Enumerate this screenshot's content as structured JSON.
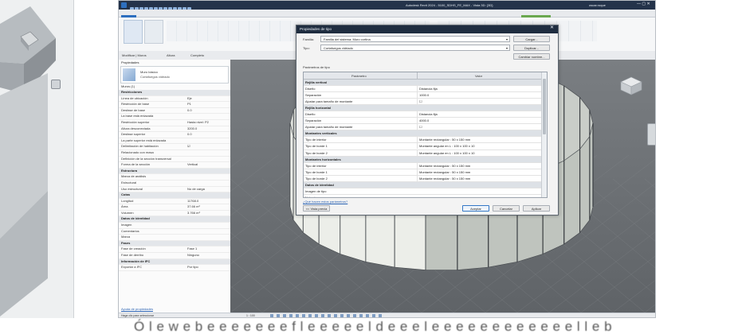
{
  "window": {
    "title": "Autodesk Revit 2024 - 5100_SDHS_FE_MAX - Vista 3D: {3D}",
    "user": "oscar.roque"
  },
  "ribbon": {
    "tabs": [
      "Archivo",
      "Arquitectura",
      "Estructura",
      "Acero",
      "Prefabricación",
      "Sistemas",
      "Insertar",
      "Anotar",
      "Analizar",
      "Masa y emplazamiento",
      "Colaborar",
      "Vista",
      "Gestionar",
      "Complementos",
      "Escalar",
      "Herramientas de Manipulación",
      "Quantification",
      "Fabricación",
      "Modificar | Muros",
      "Ver"
    ],
    "active_tab": "Archivo",
    "highlight_tab": "Modificar | Muros",
    "panel_labels": [
      "Seleccionar ▾",
      "Propiedades",
      "Portapapeles",
      "Geometría",
      "Modificar",
      "Vista",
      "Medir",
      "Crear",
      "Modo",
      "Modificar muro"
    ]
  },
  "options_bar": {
    "text": "Modificar | Muros",
    "items": [
      "Altura",
      "Completo"
    ]
  },
  "properties": {
    "header": "Propiedades",
    "type_name": "Muro básico",
    "type_sub": "Cortafuegos vidriado",
    "instance": "Muros (1)",
    "rows": [
      {
        "k": "Restricciones",
        "v": "",
        "grp": true
      },
      {
        "k": "Línea de ubicación",
        "v": "Eje"
      },
      {
        "k": "Restricción de base",
        "v": "P1"
      },
      {
        "k": "Desfase de base",
        "v": "0.0"
      },
      {
        "k": "La base está enlazada",
        "v": ""
      },
      {
        "k": "Restricción superior",
        "v": "Hasta nivel: P2"
      },
      {
        "k": "Altura desconectada",
        "v": "3200.0"
      },
      {
        "k": "Desfase superior",
        "v": "0.0"
      },
      {
        "k": "La parte superior está enlazada",
        "v": ""
      },
      {
        "k": "Delimitación de habitación",
        "v": "☑"
      },
      {
        "k": "Relacionado con masa",
        "v": ""
      },
      {
        "k": "Definición de la sección transversal",
        "v": ""
      },
      {
        "k": "Forma de la sección",
        "v": "Vertical"
      },
      {
        "k": "Estructura",
        "v": "",
        "grp": true
      },
      {
        "k": "Marca de análisis",
        "v": ""
      },
      {
        "k": "Estructural",
        "v": ""
      },
      {
        "k": "Uso estructural",
        "v": "No de carga"
      },
      {
        "k": "Cotas",
        "v": "",
        "grp": true
      },
      {
        "k": "Longitud",
        "v": "11768.0"
      },
      {
        "k": "Área",
        "v": "37.66 m²"
      },
      {
        "k": "Volumen",
        "v": "3.766 m³"
      },
      {
        "k": "Datos de identidad",
        "v": "",
        "grp": true
      },
      {
        "k": "Imagen",
        "v": ""
      },
      {
        "k": "Comentarios",
        "v": ""
      },
      {
        "k": "Marca",
        "v": ""
      },
      {
        "k": "Fases",
        "v": "",
        "grp": true
      },
      {
        "k": "Fase de creación",
        "v": "Fase 1"
      },
      {
        "k": "Fase de derribo",
        "v": "Ninguno"
      },
      {
        "k": "Información de IFC",
        "v": "",
        "grp": true
      },
      {
        "k": "Exportar a IFC",
        "v": "Por tipo"
      }
    ],
    "help_link": "Ayuda de propiedades",
    "apply": "Aplicar"
  },
  "dialog": {
    "title": "Propiedades de tipo",
    "family_label": "Familia:",
    "family_value": "Familia del sistema: Muro cortina",
    "type_label": "Tipo:",
    "type_value": "Cortafuegos vidriado",
    "load_btn": "Cargar...",
    "duplicate_btn": "Duplicar...",
    "rename_btn": "Cambiar nombre...",
    "params_label": "Parámetros de tipo",
    "col_param": "Parámetro",
    "col_value": "Valor",
    "rows": [
      {
        "p": "Rejilla vertical",
        "v": "",
        "grp": true
      },
      {
        "p": "Diseño",
        "v": "Distancia fija"
      },
      {
        "p": "Separación",
        "v": "1000.0"
      },
      {
        "p": "Ajustar para tamaño de montante",
        "v": "☐"
      },
      {
        "p": "Rejilla horizontal",
        "v": "",
        "grp": true
      },
      {
        "p": "Diseño",
        "v": "Distancia fija"
      },
      {
        "p": "Separación",
        "v": "4000.0"
      },
      {
        "p": "Ajustar para tamaño de montante",
        "v": "☐"
      },
      {
        "p": "Montantes verticales",
        "v": "",
        "grp": true
      },
      {
        "p": "Tipo de interior",
        "v": "Montante rectangular : 50 x 150 mm"
      },
      {
        "p": "Tipo de borde 1",
        "v": "Montante angular en L : 100 x 100 x 10"
      },
      {
        "p": "Tipo de borde 2",
        "v": "Montante angular en L : 100 x 100 x 10"
      },
      {
        "p": "Montantes horizontales",
        "v": "",
        "grp": true
      },
      {
        "p": "Tipo de interior",
        "v": "Montante rectangular : 50 x 150 mm"
      },
      {
        "p": "Tipo de borde 1",
        "v": "Montante rectangular : 50 x 150 mm"
      },
      {
        "p": "Tipo de borde 2",
        "v": "Montante rectangular : 50 x 150 mm"
      },
      {
        "p": "Datos de identidad",
        "v": "",
        "grp": true
      },
      {
        "p": "Imagen de tipo",
        "v": ""
      },
      {
        "p": "Nota clave",
        "v": ""
      }
    ],
    "help_link": "¿Qué hacen estos parámetros?",
    "preview_btn": "<< Vista previa",
    "ok_btn": "Aceptar",
    "cancel_btn": "Cancelar",
    "apply_btn": "Aplicar"
  },
  "status_bar": {
    "text": "Haga clic para seleccionar",
    "scale": "1 : 100"
  },
  "caption": "Ó l e w e b e e e e e e e f l e e e e e l d e e e l e e e e e e e e e e e e l l e b"
}
